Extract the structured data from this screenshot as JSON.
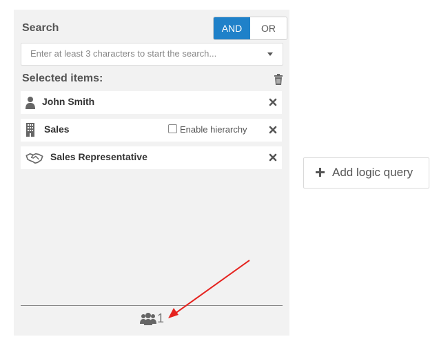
{
  "search": {
    "title": "Search",
    "placeholder": "Enter at least 3 characters to start the search...",
    "operators": {
      "and_label": "AND",
      "or_label": "OR",
      "active": "AND"
    }
  },
  "selected": {
    "title": "Selected items:",
    "items": [
      {
        "label": "John Smith",
        "icon": "user-icon"
      },
      {
        "label": "Sales",
        "icon": "building-icon",
        "hierarchy_label": "Enable hierarchy",
        "hierarchy_checked": false
      },
      {
        "label": "Sales Representative",
        "icon": "handshake-icon"
      }
    ]
  },
  "footer": {
    "count": "1",
    "icon": "users-icon"
  },
  "add_logic": {
    "label": "Add logic query",
    "icon": "plus-icon"
  },
  "colors": {
    "accent": "#1f81c9",
    "panel_bg": "#f2f2f2",
    "annotation_arrow": "#e5231f"
  }
}
